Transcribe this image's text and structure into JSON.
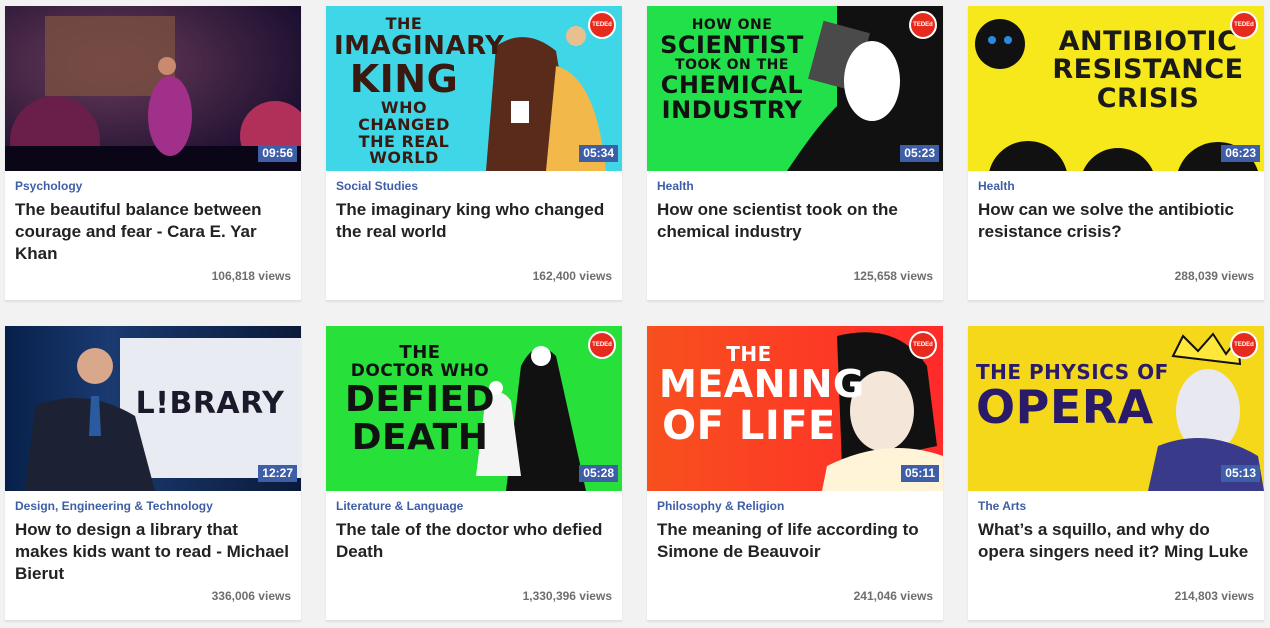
{
  "badge_label": "TEDEd",
  "cards": [
    {
      "category": "Psychology",
      "title": "The beautiful balance between courage and fear - Cara E. Yar Khan",
      "views": "106,818 views",
      "duration": "09:56",
      "thumb_text": [],
      "thumb_bg": "#2a1a4a"
    },
    {
      "category": "Social Studies",
      "title": "The imaginary king who changed the real world",
      "views": "162,400 views",
      "duration": "05:34",
      "thumb_text": [
        "THE",
        "IMAGINARY",
        "KING",
        "WHO CHANGED",
        "THE REAL WORLD"
      ],
      "thumb_bg": "#3fd6e8"
    },
    {
      "category": "Health",
      "title": "How one scientist took on the chemical industry",
      "views": "125,658 views",
      "duration": "05:23",
      "thumb_text": [
        "HOW ONE",
        "SCIENTIST",
        "TOOK ON THE",
        "CHEMICAL",
        "INDUSTRY"
      ],
      "thumb_bg": "#22e04a"
    },
    {
      "category": "Health",
      "title": "How can we solve the antibiotic resistance crisis?",
      "views": "288,039 views",
      "duration": "06:23",
      "thumb_text": [
        "ANTIBIOTIC",
        "RESISTANCE",
        "CRISIS"
      ],
      "thumb_bg": "#f7e81c"
    },
    {
      "category": "Design, Engineering & Technology",
      "title": "How to design a library that makes kids want to read - Michael Bierut",
      "views": "336,006 views",
      "duration": "12:27",
      "thumb_text": [
        "L!BRARY"
      ],
      "thumb_bg": "#0d1a3a"
    },
    {
      "category": "Literature & Language",
      "title": "The tale of the doctor who defied Death",
      "views": "1,330,396 views",
      "duration": "05:28",
      "thumb_text": [
        "THE",
        "DOCTOR WHO",
        "DEFIED",
        "DEATH"
      ],
      "thumb_bg": "#27e03a"
    },
    {
      "category": "Philosophy & Religion",
      "title": "The meaning of life according to Simone de Beauvoir",
      "views": "241,046 views",
      "duration": "05:11",
      "thumb_text": [
        "THE",
        "MEANING",
        "OF LIFE"
      ],
      "thumb_bg": "#f24a1e"
    },
    {
      "category": "The Arts",
      "title": "What’s a squillo, and why do opera singers need it? Ming Luke",
      "views": "214,803 views",
      "duration": "05:13",
      "thumb_text": [
        "THE PHYSICS OF",
        "OPERA"
      ],
      "thumb_bg": "#f5d81a"
    }
  ]
}
